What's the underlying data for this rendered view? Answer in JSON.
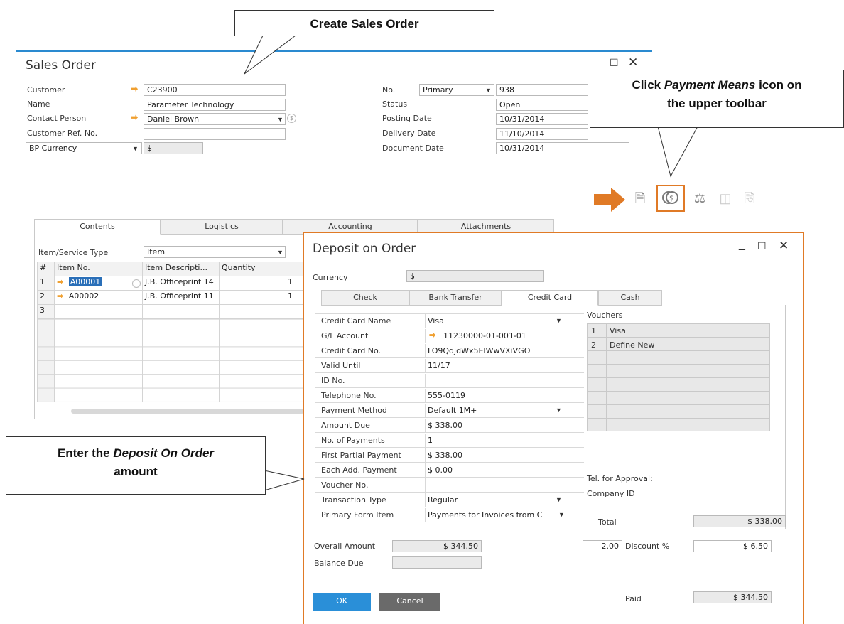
{
  "callouts": {
    "create": "Create Sales Order",
    "payment_line1_pre": "Click ",
    "payment_line1_em": "Payment Means",
    "payment_line1_post": " icon on",
    "payment_line2": "the upper toolbar",
    "deposit_line1_pre": "Enter the ",
    "deposit_line1_em": "Deposit On Order",
    "deposit_line2": "amount"
  },
  "sales_order": {
    "title": "Sales Order",
    "left_fields": [
      {
        "label": "Customer",
        "value": "C23900"
      },
      {
        "label": "Name",
        "value": "Parameter Technology"
      },
      {
        "label": "Contact Person",
        "value": "Daniel Brown"
      },
      {
        "label": "Customer Ref. No.",
        "value": ""
      }
    ],
    "currency_select": "BP Currency",
    "currency_value": "$",
    "right_fields": [
      {
        "label": "No.",
        "value": "938",
        "series": "Primary"
      },
      {
        "label": "Status",
        "value": "Open"
      },
      {
        "label": "Posting Date",
        "value": "10/31/2014"
      },
      {
        "label": "Delivery Date",
        "value": "11/10/2014"
      },
      {
        "label": "Document Date",
        "value": "10/31/2014"
      }
    ],
    "tabs": [
      "Contents",
      "Logistics",
      "Accounting",
      "Attachments"
    ],
    "item_type_label": "Item/Service Type",
    "item_type_value": "Item",
    "grid_headers": [
      "#",
      "Item No.",
      "Item Descripti...",
      "Quantity"
    ],
    "grid_rows": [
      {
        "num": "1",
        "item": "A00001",
        "desc": "J.B. Officeprint 14",
        "qty": "1"
      },
      {
        "num": "2",
        "item": "A00002",
        "desc": "J.B. Officeprint 11",
        "qty": "1"
      },
      {
        "num": "3",
        "item": "",
        "desc": "",
        "qty": ""
      }
    ]
  },
  "deposit": {
    "title": "Deposit on Order",
    "currency_label": "Currency",
    "currency_value": "$",
    "tabs": [
      "Check",
      "Bank Transfer",
      "Credit Card",
      "Cash"
    ],
    "cc_rows": [
      {
        "label": "Credit Card Name",
        "value": "Visa"
      },
      {
        "label": "G/L Account",
        "value": "11230000-01-001-01"
      },
      {
        "label": "Credit Card No.",
        "value": "LO9QdjdWx5EIWwVXiVGO"
      },
      {
        "label": "Valid Until",
        "value": "11/17"
      },
      {
        "label": "ID No.",
        "value": ""
      },
      {
        "label": "Telephone No.",
        "value": "555-0119"
      },
      {
        "label": "Payment Method",
        "value": "Default 1M+"
      },
      {
        "label": "Amount Due",
        "value": "$ 338.00"
      },
      {
        "label": "No. of Payments",
        "value": "1"
      },
      {
        "label": "First Partial Payment",
        "value": "$ 338.00"
      },
      {
        "label": "Each Add. Payment",
        "value": "$ 0.00"
      },
      {
        "label": "Voucher No.",
        "value": ""
      },
      {
        "label": "Transaction Type",
        "value": "Regular"
      },
      {
        "label": "Primary Form Item",
        "value": "Payments for Invoices from C"
      }
    ],
    "vouchers_label": "Vouchers",
    "vouchers": [
      {
        "num": "1",
        "name": "Visa"
      },
      {
        "num": "2",
        "name": "Define New"
      }
    ],
    "tel_approval": "Tel. for Approval:",
    "company_id": "Company ID",
    "total_label": "Total",
    "total_value": "$ 338.00",
    "overall_label": "Overall Amount",
    "overall_value": "$ 344.50",
    "balance_label": "Balance Due",
    "balance_value": "",
    "discount_value": "2.00",
    "discount_label": "Discount %",
    "discount_amount": "$ 6.50",
    "paid_label": "Paid",
    "paid_value": "$ 344.50",
    "ok_label": "OK",
    "cancel_label": "Cancel"
  },
  "colors": {
    "accent_orange": "#e07a26",
    "title_blue": "#2a8ad0",
    "ok_blue": "#2a8fd8",
    "cancel_grey": "#6a6a6a"
  }
}
